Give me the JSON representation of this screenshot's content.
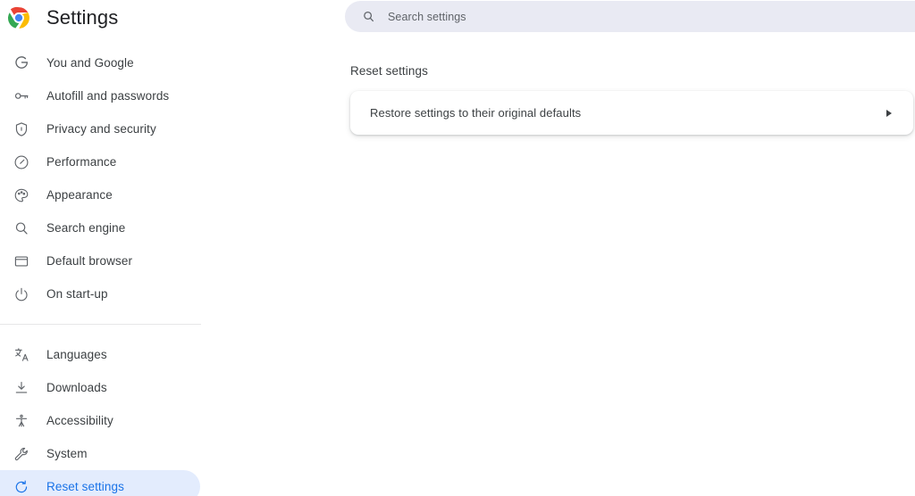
{
  "app": {
    "title": "Settings",
    "logo_icon": "chrome-logo-icon",
    "accent_color": "#1a73e8",
    "selected_bg_color": "#e3ecfd",
    "search_bg_color": "#e9eaf3",
    "text_color": "#3c4043"
  },
  "search": {
    "placeholder": "Search settings",
    "value": "",
    "icon": "search-icon"
  },
  "sidebar": {
    "groups": [
      {
        "items": [
          {
            "label": "You and Google",
            "icon": "google-g-icon",
            "selected": false
          },
          {
            "label": "Autofill and passwords",
            "icon": "key-icon",
            "selected": false
          },
          {
            "label": "Privacy and security",
            "icon": "shield-icon",
            "selected": false
          },
          {
            "label": "Performance",
            "icon": "speedometer-icon",
            "selected": false
          },
          {
            "label": "Appearance",
            "icon": "palette-icon",
            "selected": false
          },
          {
            "label": "Search engine",
            "icon": "magnifier-icon",
            "selected": false
          },
          {
            "label": "Default browser",
            "icon": "browser-window-icon",
            "selected": false
          },
          {
            "label": "On start-up",
            "icon": "power-icon",
            "selected": false
          }
        ]
      },
      {
        "items": [
          {
            "label": "Languages",
            "icon": "translate-icon",
            "selected": false
          },
          {
            "label": "Downloads",
            "icon": "download-icon",
            "selected": false
          },
          {
            "label": "Accessibility",
            "icon": "accessibility-icon",
            "selected": false
          },
          {
            "label": "System",
            "icon": "wrench-icon",
            "selected": false
          },
          {
            "label": "Reset settings",
            "icon": "restore-icon",
            "selected": true
          }
        ]
      }
    ]
  },
  "main": {
    "section_title": "Reset settings",
    "rows": [
      {
        "label": "Restore settings to their original defaults",
        "arrow": "arrow-right-icon"
      }
    ]
  }
}
